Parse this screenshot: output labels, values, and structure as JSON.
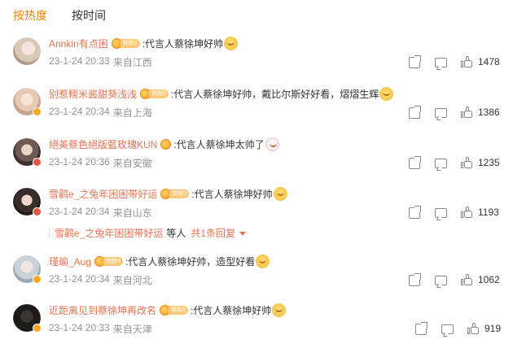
{
  "tabs": [
    {
      "label": "按热度",
      "active": true
    },
    {
      "label": "按时间",
      "active": false
    }
  ],
  "comments": [
    {
      "username": "Annkin有点困",
      "medal": "铁粉2",
      "text": ":代言人蔡徐坤好帅",
      "emoji": "laugh",
      "date": "23-1-24 20:33",
      "location": "来自江西",
      "likes": "1478",
      "verify": "none",
      "avatar_color": "#d9c7b8"
    },
    {
      "username": "别惹糯米酱甜葵浅浅",
      "medal": "铁粉5",
      "text": ":代言人蔡徐坤好帅，戴比尔斯好好看，熠熠生辉",
      "emoji": "blue",
      "date": "23-1-24 20:34",
      "location": "来自上海",
      "likes": "1386",
      "verify": "gold",
      "avatar_color": "#e7c9b6"
    },
    {
      "username": "絕美蔡色絕版藍玫瑰KUN",
      "medal": "",
      "text": ":代言人蔡徐坤太帅了",
      "emoji": "pink",
      "date": "23-1-24 20:36",
      "location": "来自安徽",
      "likes": "1235",
      "verify": "red",
      "avatar_color": "#6d5a55"
    },
    {
      "username": "雪鹳e_之兔年困困带好运",
      "medal": "铁粉2",
      "text": ":代言人蔡徐坤好帅",
      "emoji": "laugh",
      "date": "23-1-24 20:34",
      "location": "来自山东",
      "likes": "1193",
      "verify": "red",
      "avatar_color": "#3a2e2c"
    },
    {
      "username": "瑾瑜_Aug",
      "medal": "铁粉4",
      "text": ":代言人蔡徐坤好帅，造型好看",
      "emoji": "laugh",
      "date": "23-1-24 20:34",
      "location": "来自河北",
      "likes": "1062",
      "verify": "gold",
      "avatar_color": "#c9d2d8"
    },
    {
      "username": "近距离见到蔡徐坤再改名",
      "medal": "铁粉3",
      "text": ":代言人蔡徐坤好帅",
      "emoji": "laugh",
      "date": "23-1-24 20:33",
      "location": "来自天津",
      "likes": "919",
      "verify": "gold",
      "avatar_color": "#1e1b1b"
    }
  ],
  "reply": {
    "name": "雪鹳e_之兔年困困带好运",
    "deng": "等人",
    "link": "共1条回复"
  }
}
